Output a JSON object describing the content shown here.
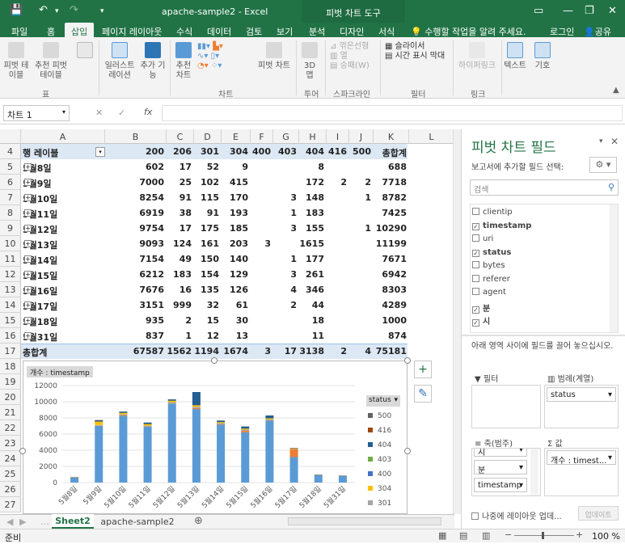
{
  "title_bar": {
    "doc_title": "apache-sample2 - Excel",
    "context_tab": "피벗 차트 도구",
    "user": "로그인",
    "share": "공유"
  },
  "tabs": [
    "파일",
    "홈",
    "삽입",
    "페이지 레이아웃",
    "수식",
    "데이터",
    "검토",
    "보기",
    "분석",
    "디자인",
    "서식"
  ],
  "active_tab": "삽입",
  "tell_me": "수행할 작업을 알려 주세요.",
  "ribbon": {
    "pivot_table": "피벗 테이블",
    "recommended_pivot": "추천 피벗 테이블",
    "table": "표",
    "group_table": "표",
    "illustrations": "일러스트레이션",
    "addins": "추가 기능",
    "recommended_charts": "추천 차트",
    "pivot_chart": "피벗 차트",
    "map3d": "3D 맵",
    "group_charts": "차트",
    "group_tour": "투어",
    "sparkline_line": "꺾은선형",
    "sparkline_col": "열",
    "sparkline_winloss": "승패(W)",
    "group_sparkline": "스파크라인",
    "slicer": "슬라이서",
    "timeline": "시간 표시 막대",
    "group_filter": "필터",
    "hyperlink": "하이퍼링크",
    "group_link": "링크",
    "text": "텍스트",
    "symbol": "기호"
  },
  "formula_bar": {
    "name_box": "차트 1",
    "fx": "fx"
  },
  "columns": [
    "A",
    "B",
    "C",
    "D",
    "E",
    "F",
    "G",
    "H",
    "I",
    "J",
    "K",
    "L"
  ],
  "row_numbers": [
    "4",
    "5",
    "6",
    "7",
    "8",
    "9",
    "10",
    "11",
    "12",
    "13",
    "14",
    "15",
    "16",
    "17",
    "18",
    "19",
    "20",
    "21",
    "22",
    "23",
    "24",
    "25",
    "26",
    "27"
  ],
  "pivot": {
    "header": [
      "행 레이블",
      "200",
      "206",
      "301",
      "304",
      "400",
      "403",
      "404",
      "416",
      "500",
      "총합계"
    ],
    "rows": [
      [
        "5월8일",
        "602",
        "17",
        "52",
        "9",
        "",
        "",
        "8",
        "",
        "",
        "688"
      ],
      [
        "5월9일",
        "7000",
        "25",
        "102",
        "415",
        "",
        "",
        "172",
        "2",
        "2",
        "7718"
      ],
      [
        "5월10일",
        "8254",
        "91",
        "115",
        "170",
        "",
        "3",
        "148",
        "",
        "1",
        "8782"
      ],
      [
        "5월11일",
        "6919",
        "38",
        "91",
        "193",
        "",
        "1",
        "183",
        "",
        "",
        "7425"
      ],
      [
        "5월12일",
        "9754",
        "17",
        "175",
        "185",
        "",
        "3",
        "155",
        "",
        "1",
        "10290"
      ],
      [
        "5월13일",
        "9093",
        "124",
        "161",
        "203",
        "3",
        "",
        "1615",
        "",
        "",
        "11199"
      ],
      [
        "5월14일",
        "7154",
        "49",
        "150",
        "140",
        "",
        "1",
        "177",
        "",
        "",
        "7671"
      ],
      [
        "5월15일",
        "6212",
        "183",
        "154",
        "129",
        "",
        "3",
        "261",
        "",
        "",
        "6942"
      ],
      [
        "5월16일",
        "7676",
        "16",
        "135",
        "126",
        "",
        "4",
        "346",
        "",
        "",
        "8303"
      ],
      [
        "5월17일",
        "3151",
        "999",
        "32",
        "61",
        "",
        "2",
        "44",
        "",
        "",
        "4289"
      ],
      [
        "5월18일",
        "935",
        "2",
        "15",
        "30",
        "",
        "",
        "18",
        "",
        "",
        "1000"
      ],
      [
        "5월31일",
        "837",
        "1",
        "12",
        "13",
        "",
        "",
        "11",
        "",
        "",
        "874"
      ]
    ],
    "total": [
      "총합계",
      "67587",
      "1562",
      "1194",
      "1674",
      "3",
      "17",
      "3138",
      "2",
      "4",
      "75181"
    ]
  },
  "chart_data": {
    "type": "bar",
    "stacked": true,
    "value_field_button": "개수 : timestamp",
    "legend_button": "status",
    "legend_placement": "right",
    "categories": [
      "5월8일",
      "5월9일",
      "5월10일",
      "5월11일",
      "5월12일",
      "5월13일",
      "5월14일",
      "5월15일",
      "5월16일",
      "5월17일",
      "5월18일",
      "5월31일"
    ],
    "ylim": [
      0,
      12000
    ],
    "yticks": [
      "0",
      "2000",
      "4000",
      "6000",
      "8000",
      "10000",
      "12000"
    ],
    "series": [
      {
        "name": "200",
        "color": "#5b9bd5",
        "values": [
          602,
          7000,
          8254,
          6919,
          9754,
          9093,
          7154,
          6212,
          7676,
          3151,
          935,
          837
        ]
      },
      {
        "name": "206",
        "color": "#ed7d31",
        "values": [
          17,
          25,
          91,
          38,
          17,
          124,
          49,
          183,
          16,
          999,
          2,
          1
        ]
      },
      {
        "name": "301",
        "color": "#a5a5a5",
        "values": [
          52,
          102,
          115,
          91,
          175,
          161,
          150,
          154,
          135,
          32,
          15,
          12
        ]
      },
      {
        "name": "304",
        "color": "#ffc000",
        "values": [
          9,
          415,
          170,
          193,
          185,
          203,
          140,
          129,
          126,
          61,
          30,
          13
        ]
      },
      {
        "name": "400",
        "color": "#4472c4",
        "values": [
          0,
          0,
          0,
          0,
          0,
          3,
          0,
          0,
          0,
          0,
          0,
          0
        ]
      },
      {
        "name": "403",
        "color": "#70ad47",
        "values": [
          0,
          0,
          3,
          1,
          3,
          0,
          1,
          3,
          4,
          2,
          0,
          0
        ]
      },
      {
        "name": "404",
        "color": "#255e91",
        "values": [
          8,
          172,
          148,
          183,
          155,
          1615,
          177,
          261,
          346,
          44,
          18,
          11
        ]
      },
      {
        "name": "416",
        "color": "#9e480e",
        "values": [
          0,
          2,
          0,
          0,
          0,
          0,
          0,
          0,
          0,
          0,
          0,
          0
        ]
      },
      {
        "name": "500",
        "color": "#636363",
        "values": [
          0,
          2,
          1,
          0,
          1,
          0,
          0,
          0,
          0,
          0,
          0,
          0
        ]
      }
    ],
    "legend_visible": [
      "500",
      "416",
      "404",
      "403",
      "400",
      "304",
      "301"
    ]
  },
  "sheet_tabs": [
    "Sheet2",
    "apache-sample2"
  ],
  "active_sheet": "Sheet2",
  "status": {
    "ready": "준비",
    "zoom": "100 %"
  },
  "pane": {
    "title": "피벗 차트 필드",
    "subtitle": "보고서에 추가할 필드 선택:",
    "search_placeholder": "검색",
    "fields": [
      {
        "name": "clientip",
        "checked": false
      },
      {
        "name": "timestamp",
        "checked": true
      },
      {
        "name": "uri",
        "checked": false
      },
      {
        "name": "status",
        "checked": true
      },
      {
        "name": "bytes",
        "checked": false
      },
      {
        "name": "referer",
        "checked": false
      },
      {
        "name": "agent",
        "checked": false
      },
      {
        "name": "분",
        "checked": true
      },
      {
        "name": "시",
        "checked": true
      }
    ],
    "drag_hint": "아래 영역 사이에 필드를 끌어 놓으십시오.",
    "filter_label": "필터",
    "legend_label": "범례(계열)",
    "legend_item": "status",
    "axis_label": "축(범주)",
    "axis_items": [
      "시",
      "분",
      "timestamp"
    ],
    "values_label": "값",
    "values_item": "개수 : timest...",
    "defer_label": "나중에 레이아웃 업데...",
    "update_button": "업데이트"
  }
}
